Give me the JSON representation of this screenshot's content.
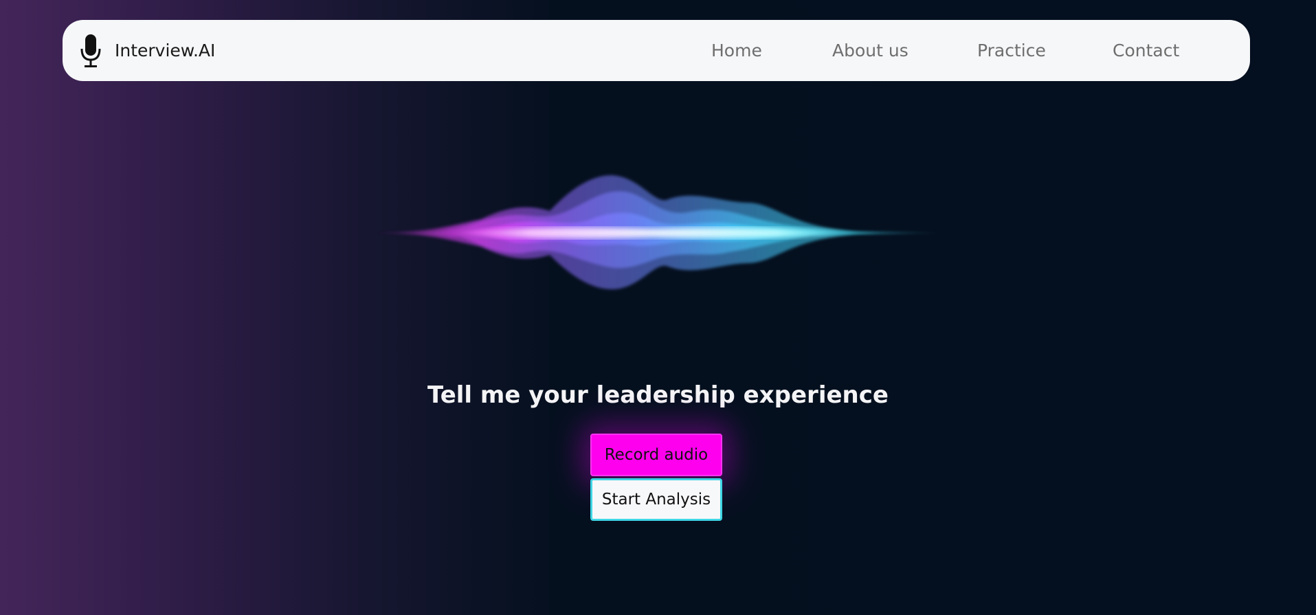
{
  "brand": {
    "name": "Interview.AI",
    "icon": "microphone-icon"
  },
  "nav": {
    "home": "Home",
    "about": "About us",
    "practice": "Practice",
    "contact": "Contact"
  },
  "main": {
    "question": "Tell me your leadership experience",
    "record_button": "Record audio",
    "analysis_button": "Start Analysis"
  },
  "colors": {
    "record_button": "#ff00ee",
    "analysis_border": "#3ed6e4",
    "wave_magenta": "#e040fb",
    "wave_blue": "#6c7cff",
    "wave_cyan": "#45e6ff"
  }
}
